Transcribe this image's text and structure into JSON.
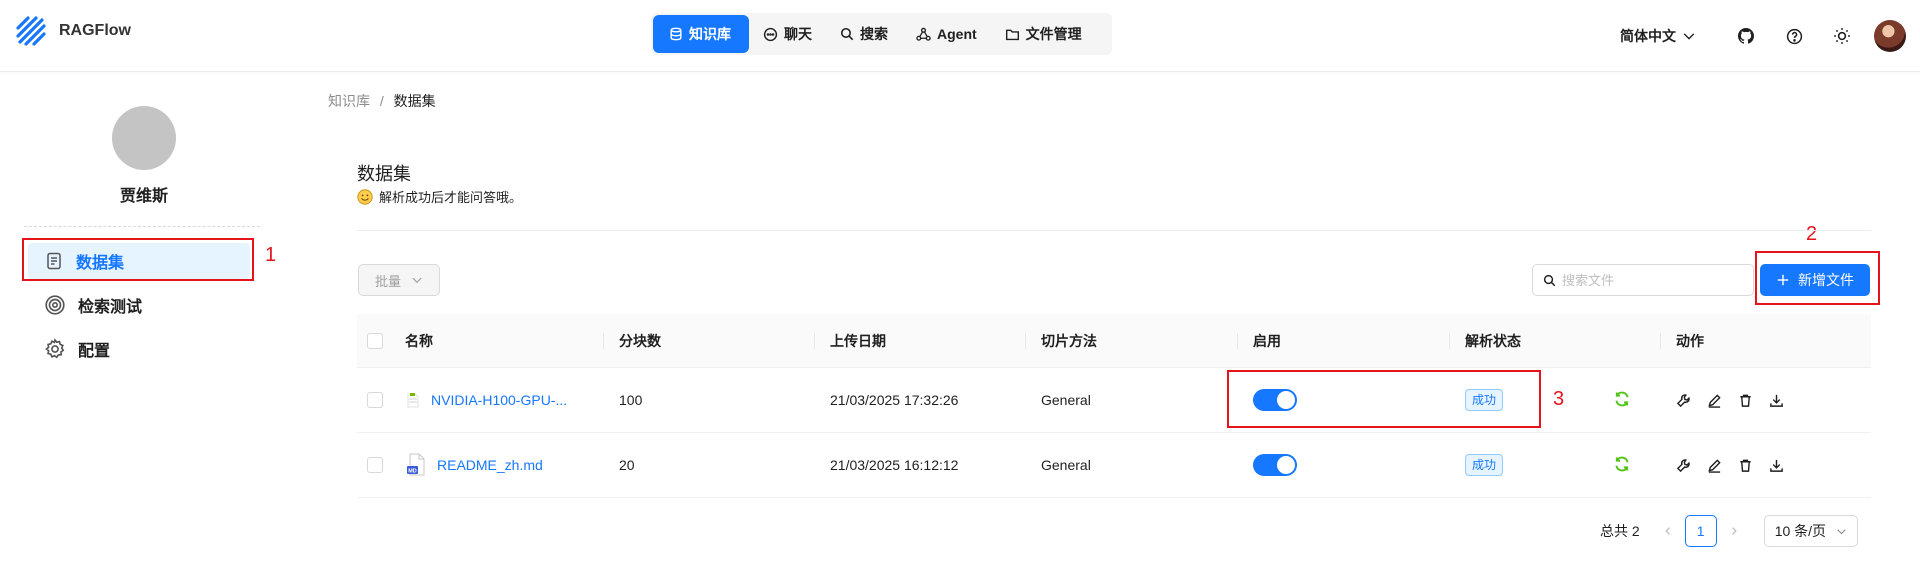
{
  "app": {
    "brand": "RAGFlow"
  },
  "nav": {
    "items": [
      {
        "label": "知识库",
        "icon": "database-icon",
        "active": true
      },
      {
        "label": "聊天",
        "icon": "chat-icon"
      },
      {
        "label": "搜索",
        "icon": "search-icon"
      },
      {
        "label": "Agent",
        "icon": "agent-icon"
      },
      {
        "label": "文件管理",
        "icon": "folder-icon"
      }
    ]
  },
  "header": {
    "language": "简体中文",
    "icons": [
      "github-icon",
      "help-icon",
      "theme-sun-icon",
      "user-avatar"
    ]
  },
  "sidebar": {
    "user_name": "贾维斯",
    "items": [
      {
        "label": "数据集",
        "icon": "document-icon",
        "active": true
      },
      {
        "label": "检索测试",
        "icon": "target-icon"
      },
      {
        "label": "配置",
        "icon": "settings-icon"
      }
    ]
  },
  "annotations": {
    "n1": "1",
    "n2": "2",
    "n3": "3"
  },
  "breadcrumb": {
    "root": "知识库",
    "sep": "/",
    "current": "数据集"
  },
  "page": {
    "title": "数据集",
    "subtitle": "解析成功后才能问答哦。"
  },
  "toolbar": {
    "batch_label": "批量",
    "search_placeholder": "搜索文件",
    "add_label": "新增文件"
  },
  "table": {
    "headers": [
      "名称",
      "分块数",
      "上传日期",
      "切片方法",
      "启用",
      "解析状态",
      "动作"
    ],
    "rows": [
      {
        "name": "NVIDIA-H100-GPU-...",
        "file_icon": "pdf-file-icon",
        "chunks": "100",
        "date": "21/03/2025 17:32:26",
        "method": "General",
        "enabled": true,
        "status": "成功"
      },
      {
        "name": "README_zh.md",
        "file_icon": "md-file-icon",
        "chunks": "20",
        "date": "21/03/2025 16:12:12",
        "method": "General",
        "enabled": true,
        "status": "成功"
      }
    ]
  },
  "pagination": {
    "total": "总共 2",
    "page": "1",
    "page_size": "10 条/页"
  },
  "colors": {
    "primary": "#1677ff",
    "annotation": "#e5141b",
    "success": "#52c41a"
  }
}
